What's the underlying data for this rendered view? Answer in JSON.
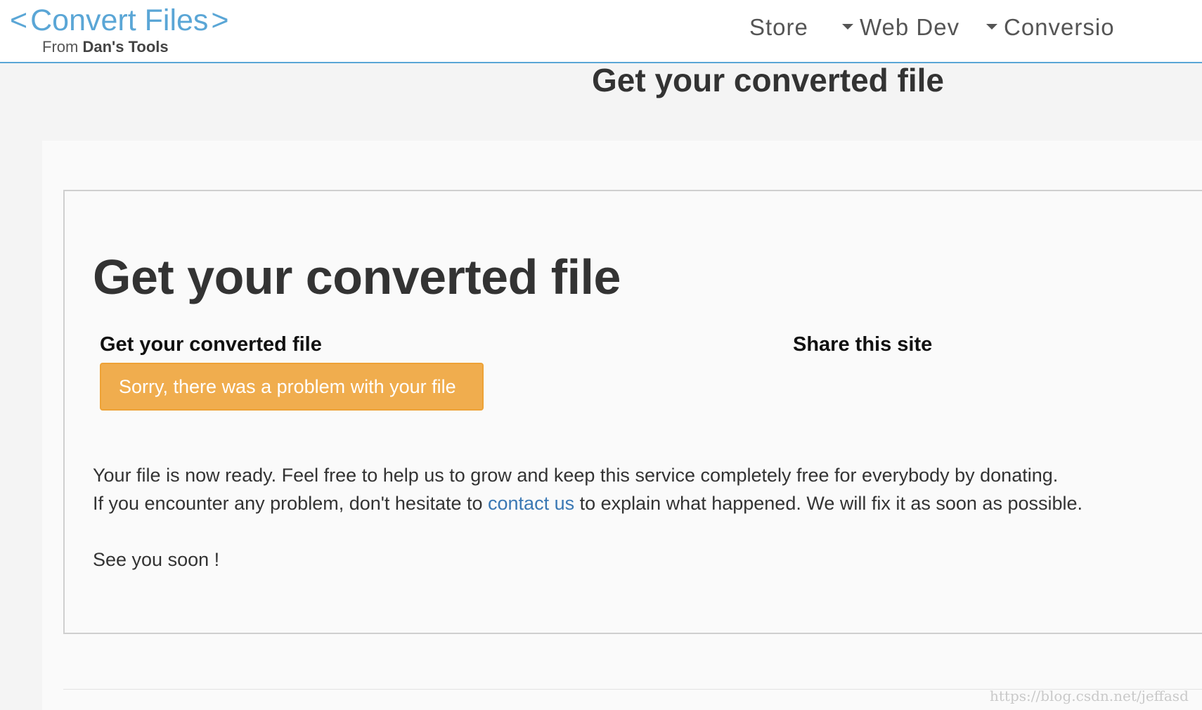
{
  "header": {
    "logo_left_bracket": "<",
    "logo_title": "Convert Files",
    "logo_right_bracket": ">",
    "logo_sub_prefix": "From ",
    "logo_sub_brand": "Dan's Tools",
    "nav": {
      "store": "Store",
      "web_dev": "Web Dev",
      "conversion": "Conversio"
    }
  },
  "page_title": "Get your converted file",
  "panel": {
    "title": "Get your converted file",
    "left_heading": "Get your converted file",
    "error_button": "Sorry, there was a problem with your file",
    "right_heading": "Share this site",
    "message_line1": "Your file is now ready. Feel free to help us to grow and keep this service completely free for everybody by donating.",
    "message_line2_before": "If you encounter any problem, don't hesitate to ",
    "message_link": "contact us",
    "message_line2_after": " to explain what happened. We will fix it as soon as possible.",
    "signoff": "See you soon !"
  },
  "watermark": "https://blog.csdn.net/jeffasd",
  "colors": {
    "brand_blue": "#5aa6d6",
    "warning_orange": "#f0ad4e",
    "link_blue": "#3a78b4"
  },
  "icons": {
    "nav_dropdown": "caret-down-icon"
  }
}
